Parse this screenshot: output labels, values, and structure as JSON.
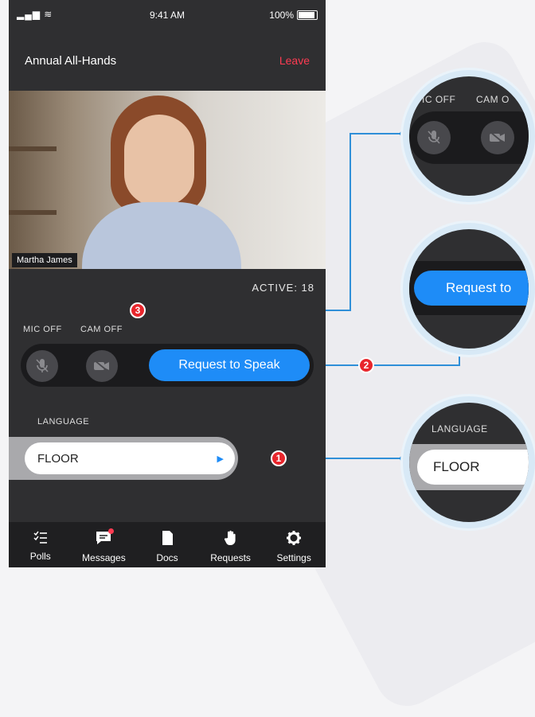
{
  "status_bar": {
    "signal": "……",
    "time": "9:41 AM",
    "battery": "100%"
  },
  "header": {
    "title": "Annual All-Hands",
    "leave_label": "Leave"
  },
  "video": {
    "speaker_name": "Martha James"
  },
  "participants": {
    "active_label": "ACTIVE: 18"
  },
  "controls": {
    "mic_label": "MIC OFF",
    "cam_label": "CAM OFF",
    "speak_label": "Request to Speak"
  },
  "language": {
    "label": "LANGUAGE",
    "value": "FLOOR"
  },
  "tabs": [
    {
      "label": "Polls",
      "icon": "polls-icon"
    },
    {
      "label": "Messages",
      "icon": "messages-icon"
    },
    {
      "label": "Docs",
      "icon": "docs-icon"
    },
    {
      "label": "Requests",
      "icon": "hand-icon"
    },
    {
      "label": "Settings",
      "icon": "gear-icon"
    }
  ],
  "callouts": {
    "c1": {
      "number": "1",
      "label": "LANGUAGE",
      "value": "FLOOR"
    },
    "c2": {
      "number": "2",
      "label": "Request to"
    },
    "c3": {
      "number": "3",
      "mic": "IC OFF",
      "cam": "CAM O"
    }
  },
  "colors": {
    "accent": "#1e8cf7",
    "leave": "#ff3b52",
    "callout": "#e8262c",
    "line": "#2f8fd8"
  }
}
